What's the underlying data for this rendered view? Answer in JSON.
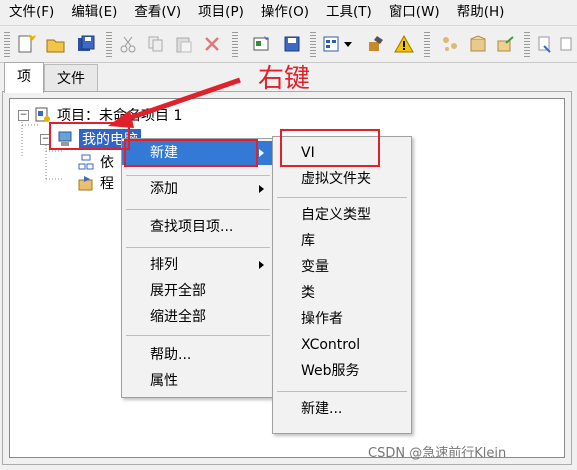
{
  "menubar": [
    "文件(F)",
    "编辑(E)",
    "查看(V)",
    "项目(P)",
    "操作(O)",
    "工具(T)",
    "窗口(W)",
    "帮助(H)"
  ],
  "tabs": {
    "items": "项",
    "files": "文件"
  },
  "tree": {
    "project_prefix": "项目：",
    "project_name": "未命名项目 1",
    "computer": "我的电脑",
    "dependencies": "依",
    "build": "程"
  },
  "context_menu": {
    "new": "新建",
    "add": "添加",
    "find": "查找项目项...",
    "arrange": "排列",
    "expand_all": "展开全部",
    "collapse_all": "缩进全部",
    "help": "帮助...",
    "properties": "属性"
  },
  "submenu": {
    "vi": "VI",
    "virtual_folder": "虚拟文件夹",
    "custom_type": "自定义类型",
    "library": "库",
    "variable": "变量",
    "class": "类",
    "actor": "操作者",
    "xcontrol": "XControl",
    "web_service": "Web服务",
    "new_dots": "新建..."
  },
  "annotation": "右键",
  "watermark": "CSDN @急速前行Klein",
  "colors": {
    "highlight": "#3579d6",
    "annotation_red": "#e0202a",
    "tree_selection": "#3064c8"
  }
}
